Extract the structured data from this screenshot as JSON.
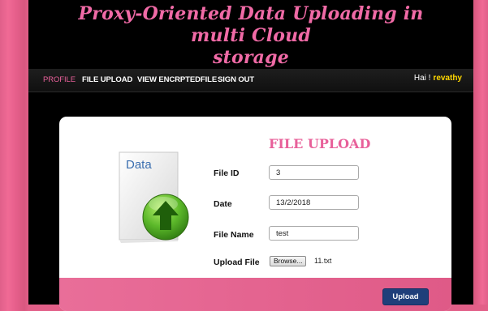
{
  "header": {
    "title_line1": "Proxy-Oriented Data Uploading in multi Cloud",
    "title_line2": "storage"
  },
  "nav": {
    "items": [
      "PROFILE",
      "FILE UPLOAD",
      "VIEW ENCRPTEDFILE",
      "SIGN OUT"
    ],
    "active": "PROFILE",
    "greeting_prefix": "Hai !",
    "username": "revathy"
  },
  "form": {
    "title": "FILE UPLOAD",
    "illustration_label": "Data",
    "fields": {
      "file_id": {
        "label": "File ID",
        "value": "3"
      },
      "date": {
        "label": "Date",
        "value": "13/2/2018"
      },
      "file_name": {
        "label": "File Name",
        "value": "test"
      },
      "upload_file": {
        "label": "Upload File",
        "browse_label": "Browse...",
        "selected_file": "11.txt"
      }
    },
    "submit_label": "Upload"
  },
  "colors": {
    "accent_pink": "#e8609a",
    "username_yellow": "#ffd700",
    "button_navy": "#1f3f7a",
    "page_pink": "#e05f8a",
    "banner_bg": "#000000"
  }
}
